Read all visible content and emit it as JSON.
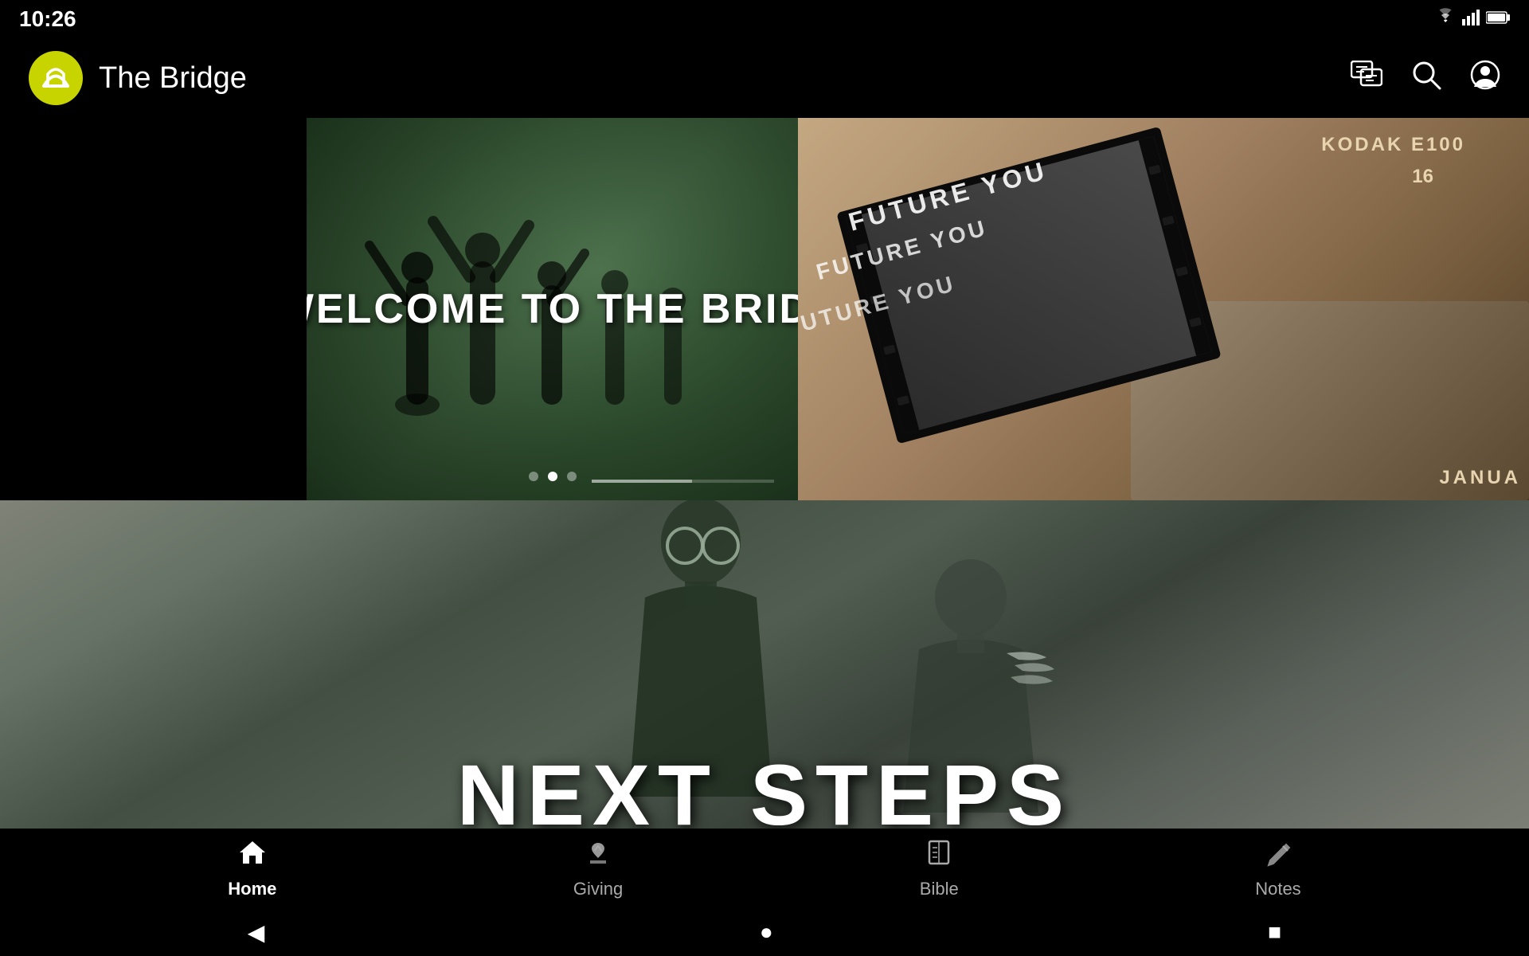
{
  "statusBar": {
    "time": "10:26",
    "icons": [
      "wifi",
      "signal",
      "battery"
    ]
  },
  "appBar": {
    "title": "The Bridge",
    "icons": {
      "messages": "💬",
      "search": "🔍",
      "account": "👤"
    }
  },
  "heroSlide1": {
    "title": "WELCOME TO THE BRIDGE",
    "dots": [
      {
        "active": false
      },
      {
        "active": true
      },
      {
        "active": false
      }
    ]
  },
  "heroSlide2": {
    "kodakLabel": "KODAK E100",
    "e100Label": "E100",
    "num16": "16",
    "futureYou1": "FUTURE YOU",
    "futureYou2": "FUTURE YOU",
    "futureYou3": "FUTURE YOU",
    "jan": "JANUA"
  },
  "nextSteps": {
    "title": "NEXT STEPS"
  },
  "bottomNav": {
    "items": [
      {
        "id": "home",
        "label": "Home",
        "active": true
      },
      {
        "id": "giving",
        "label": "Giving",
        "active": false
      },
      {
        "id": "bible",
        "label": "Bible",
        "active": false
      },
      {
        "id": "notes",
        "label": "Notes",
        "active": false
      }
    ]
  },
  "sysNav": {
    "back": "◀",
    "home": "●",
    "recent": "■"
  }
}
